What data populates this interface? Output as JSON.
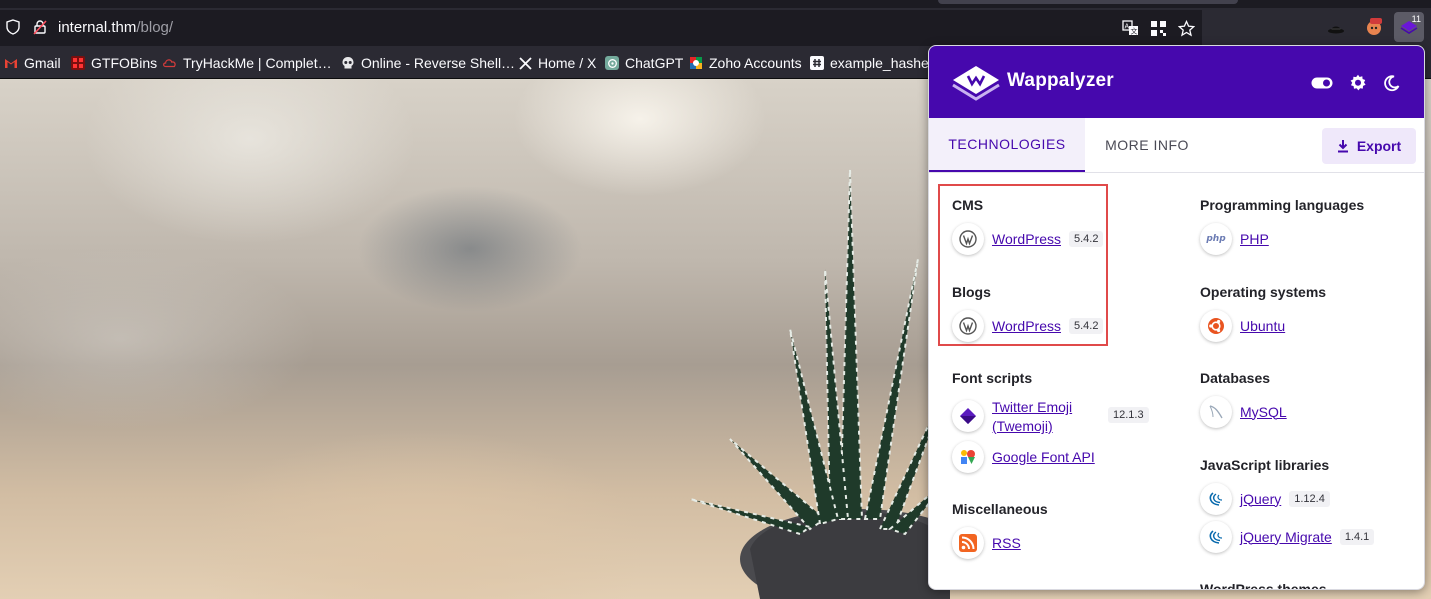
{
  "browser": {
    "url_host": "internal.thm",
    "url_path": "/blog/",
    "extension_badge": "11"
  },
  "bookmarks": [
    {
      "label": "Gmail",
      "icon": "gmail-icon"
    },
    {
      "label": "GTFOBins",
      "icon": "gtfobins-icon"
    },
    {
      "label": "TryHackMe | Complet…",
      "icon": "tryhackme-icon"
    },
    {
      "label": "Online - Reverse Shell…",
      "icon": "skull-icon"
    },
    {
      "label": "Home / X",
      "icon": "x-icon"
    },
    {
      "label": "ChatGPT",
      "icon": "chatgpt-icon"
    },
    {
      "label": "Zoho Accounts",
      "icon": "zoho-icon"
    },
    {
      "label": "example_hashes",
      "icon": "hashcat-icon"
    }
  ],
  "wappalyzer": {
    "title": "Wappalyzer",
    "tabs": [
      "TECHNOLOGIES",
      "MORE INFO"
    ],
    "export_label": "Export",
    "left_column": [
      {
        "category": "CMS",
        "items": [
          {
            "name": "WordPress",
            "version": "5.4.2",
            "icon": "wordpress-icon"
          }
        ]
      },
      {
        "category": "Blogs",
        "items": [
          {
            "name": "WordPress",
            "version": "5.4.2",
            "icon": "wordpress-icon"
          }
        ]
      },
      {
        "category": "Font scripts",
        "items": [
          {
            "name": "Twitter Emoji (Twemoji)",
            "version": "12.1.3",
            "icon": "twemoji-icon"
          },
          {
            "name": "Google Font API",
            "version": "",
            "icon": "google-font-icon"
          }
        ]
      },
      {
        "category": "Miscellaneous",
        "items": [
          {
            "name": "RSS",
            "version": "",
            "icon": "rss-icon"
          }
        ]
      }
    ],
    "right_column": [
      {
        "category": "Programming languages",
        "items": [
          {
            "name": "PHP",
            "version": "",
            "icon": "php-icon"
          }
        ]
      },
      {
        "category": "Operating systems",
        "items": [
          {
            "name": "Ubuntu",
            "version": "",
            "icon": "ubuntu-icon"
          }
        ]
      },
      {
        "category": "Databases",
        "items": [
          {
            "name": "MySQL",
            "version": "",
            "icon": "mysql-icon"
          }
        ]
      },
      {
        "category": "JavaScript libraries",
        "items": [
          {
            "name": "jQuery",
            "version": "1.12.4",
            "icon": "jquery-icon"
          },
          {
            "name": "jQuery Migrate",
            "version": "1.4.1",
            "icon": "jquery-icon"
          }
        ]
      },
      {
        "category": "WordPress themes",
        "items": []
      }
    ]
  },
  "colors": {
    "brand": "#4608ad",
    "highlight_border": "#e04a4a"
  }
}
